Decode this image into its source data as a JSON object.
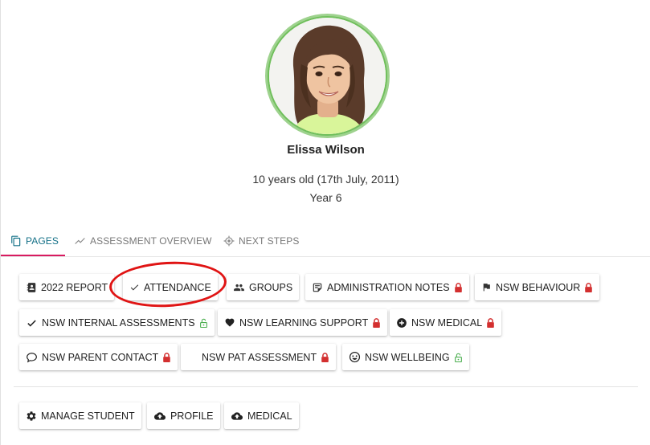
{
  "student": {
    "name": "Elissa Wilson",
    "age_text": "10 years old (17th July, 2011)",
    "year_text": "Year 6"
  },
  "tabs": [
    {
      "label": "PAGES",
      "icon": "copy-icon",
      "active": true
    },
    {
      "label": "ASSESSMENT OVERVIEW",
      "icon": "trending-icon",
      "active": false
    },
    {
      "label": "NEXT STEPS",
      "icon": "target-icon",
      "active": false
    }
  ],
  "pages": [
    {
      "label": "2022 REPORT",
      "icon": "contacts-book-icon",
      "locked": false
    },
    {
      "label": "ATTENDANCE",
      "icon": "check-icon",
      "locked": false
    },
    {
      "label": "GROUPS",
      "icon": "people-icon",
      "locked": false
    },
    {
      "label": "ADMINISTRATION NOTES",
      "icon": "note-icon",
      "locked": true
    },
    {
      "label": "NSW BEHAVIOUR",
      "icon": "flag-icon",
      "locked": true
    },
    {
      "label": "NSW INTERNAL ASSESSMENTS",
      "icon": "check-icon",
      "locked": "open"
    },
    {
      "label": "NSW LEARNING SUPPORT",
      "icon": "heart-icon",
      "locked": true
    },
    {
      "label": "NSW MEDICAL",
      "icon": "plus-circle-icon",
      "locked": true
    },
    {
      "label": "NSW PARENT CONTACT",
      "icon": "speech-bubble-icon",
      "locked": true
    },
    {
      "label": "NSW PAT ASSESSMENT",
      "icon": "",
      "locked": true
    },
    {
      "label": "NSW WELLBEING",
      "icon": "smiley-icon",
      "locked": "open"
    }
  ],
  "actions": [
    {
      "label": "MANAGE STUDENT",
      "icon": "gear-icon"
    },
    {
      "label": "PROFILE",
      "icon": "cloud-upload-icon"
    },
    {
      "label": "MEDICAL",
      "icon": "cloud-upload-icon"
    }
  ],
  "colors": {
    "accent_teal": "#137087",
    "tab_underline": "#d81b60",
    "lock_red": "#d32f2f",
    "lock_green": "#4caf50",
    "avatar_ring": "#8fcd7e",
    "annotation_red": "#e01414"
  }
}
